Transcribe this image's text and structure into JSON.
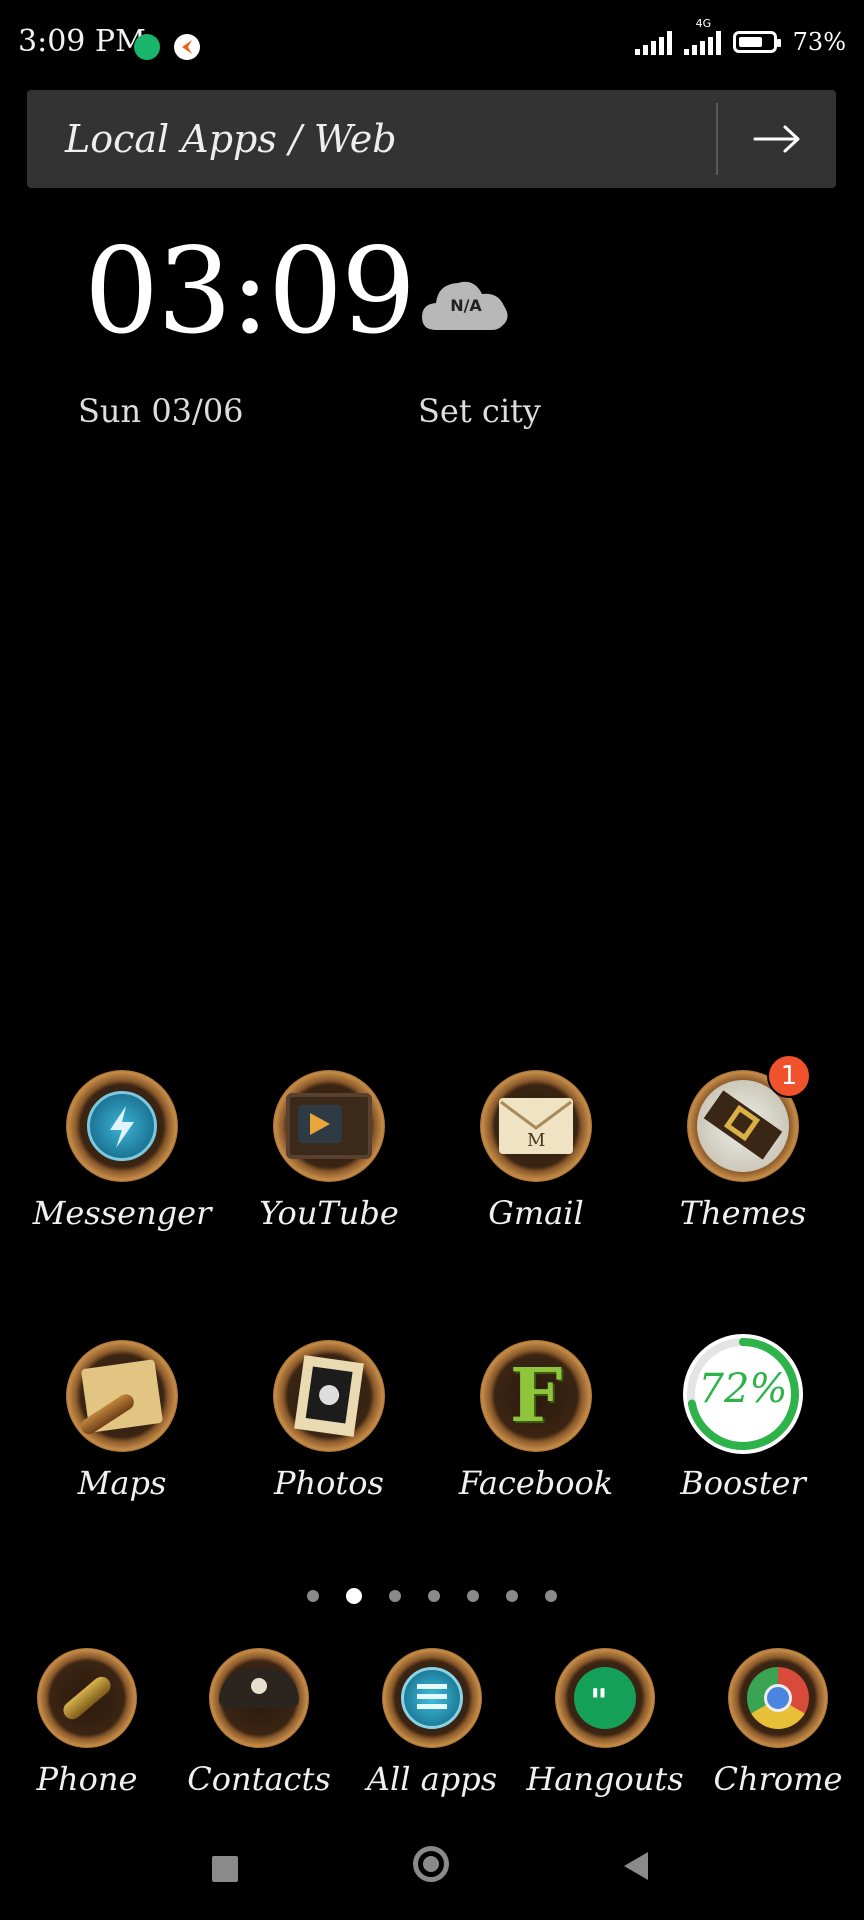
{
  "status_bar": {
    "time": "3:09 PM",
    "network_type": "4G",
    "battery": "73%",
    "battery_level": 0.73
  },
  "search": {
    "placeholder": "Local Apps / Web"
  },
  "clock_widget": {
    "time": "03:09",
    "date": "Sun 03/06",
    "weather": "N/A",
    "city": "Set city"
  },
  "apps": {
    "messenger": "Messenger",
    "youtube": "YouTube",
    "gmail": "Gmail",
    "themes": "Themes",
    "themes_badge": "1",
    "maps": "Maps",
    "photos": "Photos",
    "facebook": "Facebook",
    "booster": "Booster",
    "booster_percent": "72%",
    "booster_level": 0.72
  },
  "page_indicator": {
    "pages": 7,
    "current": 2
  },
  "dock": {
    "phone": "Phone",
    "contacts": "Contacts",
    "all_apps": "All apps",
    "hangouts": "Hangouts",
    "chrome": "Chrome"
  },
  "colors": {
    "background": "#000000",
    "search_bar": "#333333",
    "badge": "#f0522b",
    "booster_green": "#2db34a",
    "icon_frame": "#c58b47"
  }
}
